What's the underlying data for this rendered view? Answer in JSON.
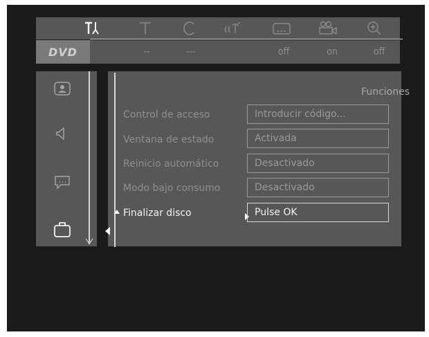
{
  "topbar": {
    "icons": [
      "wrench-icon",
      "title-icon",
      "chapter-icon",
      "audio-icon",
      "subtitle-icon",
      "camera-angle-icon",
      "zoom-icon"
    ]
  },
  "values": {
    "logo": "DVD",
    "title": "--",
    "chapter": "---",
    "subtitle": "off",
    "angle": "on",
    "zoom": "off"
  },
  "sidebar": {
    "icons": [
      "picture-icon",
      "speaker-icon",
      "speech-bubble-icon",
      "briefcase-icon"
    ]
  },
  "menu": {
    "title": "Funciones",
    "rows": [
      {
        "label": "Control de acceso",
        "value": "Introducir código..."
      },
      {
        "label": "Ventana de estado",
        "value": "Activada"
      },
      {
        "label": "Reinicio automático",
        "value": "Desactivado"
      },
      {
        "label": "Modo bajo consumo",
        "value": "Desactivado"
      },
      {
        "label": "Finalizar disco",
        "value": "Pulse OK"
      }
    ]
  }
}
